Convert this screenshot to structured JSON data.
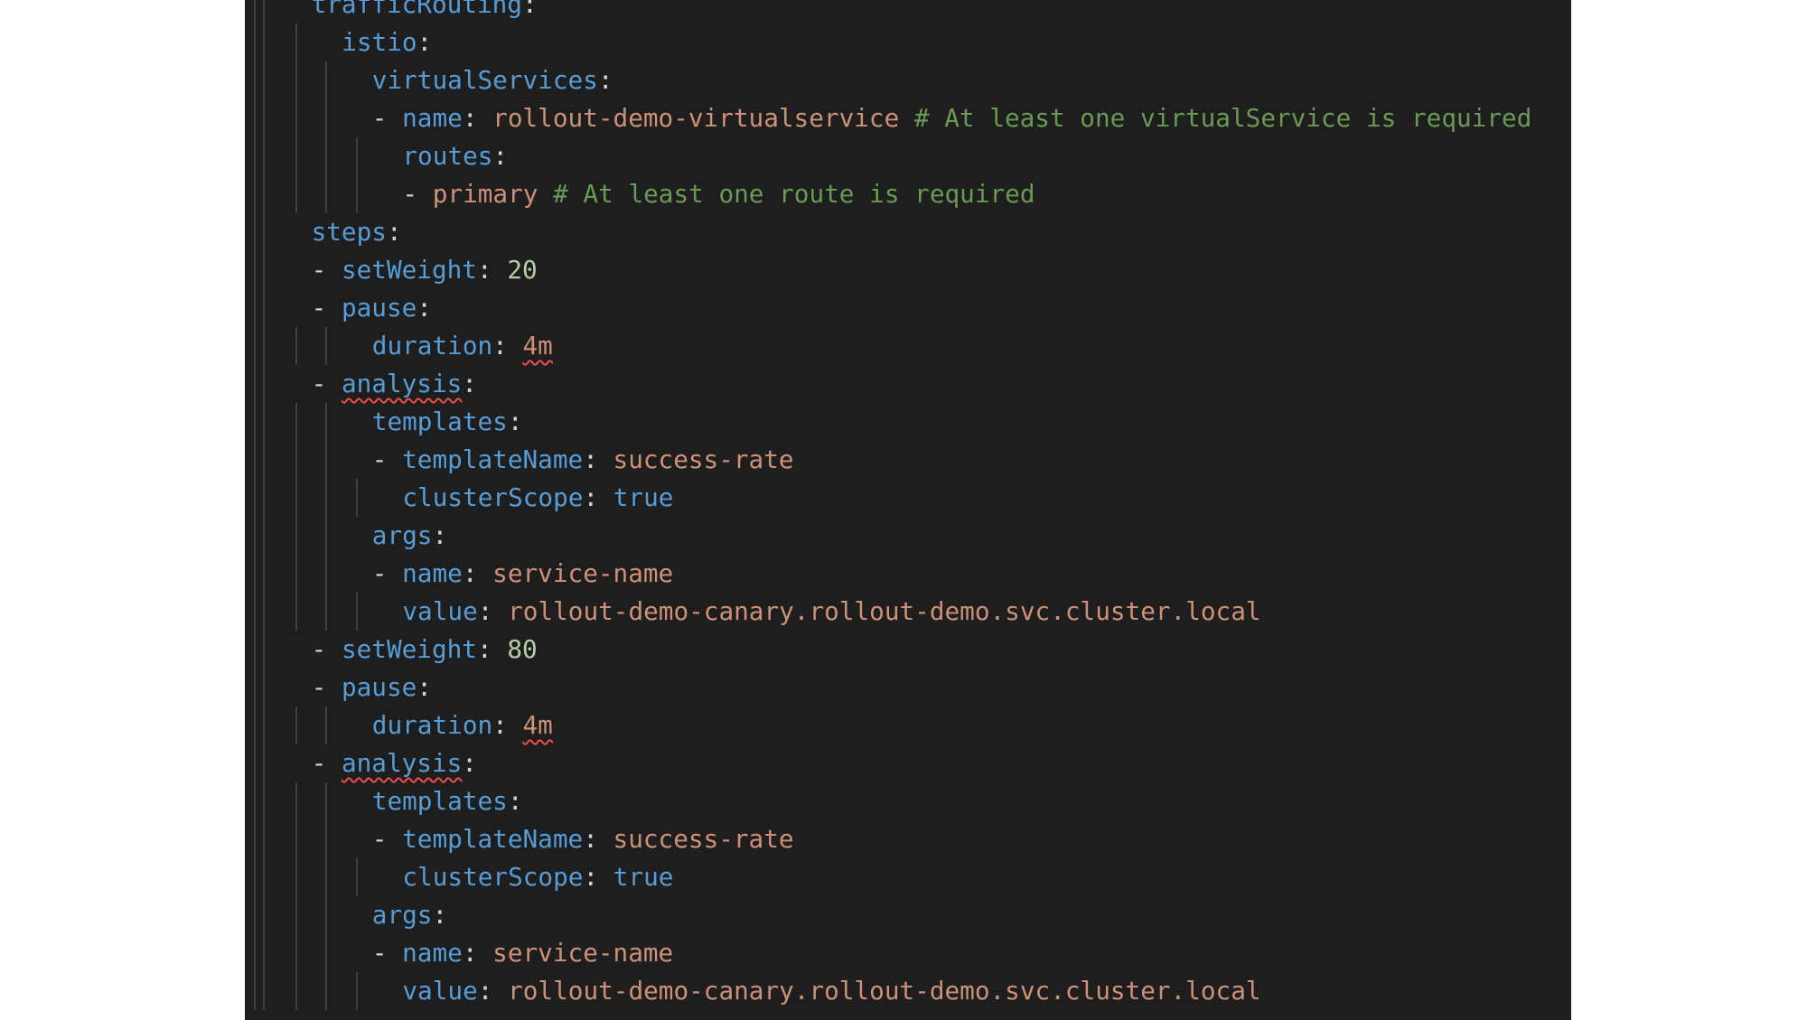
{
  "editor": {
    "language": "yaml",
    "colors": {
      "background": "#1e1e1e",
      "key": "#569cd6",
      "string": "#ce9178",
      "number": "#b5cea8",
      "boolean": "#569cd6",
      "comment": "#6a9955",
      "punctuation": "#d4d4d4",
      "error_squiggle": "#f14c4c"
    },
    "lines": [
      {
        "indent": 2,
        "tokens": [
          {
            "t": "trafficRouting",
            "c": "key"
          },
          {
            "t": ":",
            "c": "punct"
          }
        ]
      },
      {
        "indent": 3,
        "tokens": [
          {
            "t": "istio",
            "c": "key"
          },
          {
            "t": ":",
            "c": "punct"
          }
        ]
      },
      {
        "indent": 4,
        "tokens": [
          {
            "t": "virtualServices",
            "c": "key"
          },
          {
            "t": ":",
            "c": "punct"
          }
        ]
      },
      {
        "indent": 4,
        "tokens": [
          {
            "t": "- ",
            "c": "dash"
          },
          {
            "t": "name",
            "c": "key"
          },
          {
            "t": ": ",
            "c": "punct"
          },
          {
            "t": "rollout-demo-virtualservice ",
            "c": "str"
          },
          {
            "t": "# At least one virtualService is required",
            "c": "comment"
          }
        ]
      },
      {
        "indent": 5,
        "tokens": [
          {
            "t": "routes",
            "c": "key"
          },
          {
            "t": ":",
            "c": "punct"
          }
        ]
      },
      {
        "indent": 5,
        "tokens": [
          {
            "t": "- ",
            "c": "dash"
          },
          {
            "t": "primary ",
            "c": "str"
          },
          {
            "t": "# At least one route is required",
            "c": "comment"
          }
        ]
      },
      {
        "indent": 2,
        "tokens": [
          {
            "t": "steps",
            "c": "key"
          },
          {
            "t": ":",
            "c": "punct"
          }
        ]
      },
      {
        "indent": 2,
        "tokens": [
          {
            "t": "- ",
            "c": "dash"
          },
          {
            "t": "setWeight",
            "c": "key"
          },
          {
            "t": ": ",
            "c": "punct"
          },
          {
            "t": "20",
            "c": "num"
          }
        ]
      },
      {
        "indent": 2,
        "tokens": [
          {
            "t": "- ",
            "c": "dash"
          },
          {
            "t": "pause",
            "c": "key"
          },
          {
            "t": ":",
            "c": "punct"
          }
        ]
      },
      {
        "indent": 4,
        "tokens": [
          {
            "t": "duration",
            "c": "key"
          },
          {
            "t": ": ",
            "c": "punct"
          },
          {
            "t": "4m",
            "c": "str",
            "squiggle": true
          }
        ]
      },
      {
        "indent": 2,
        "tokens": [
          {
            "t": "- ",
            "c": "dash"
          },
          {
            "t": "analysis",
            "c": "key",
            "squiggle": true
          },
          {
            "t": ":",
            "c": "punct"
          }
        ]
      },
      {
        "indent": 4,
        "tokens": [
          {
            "t": "templates",
            "c": "key"
          },
          {
            "t": ":",
            "c": "punct"
          }
        ]
      },
      {
        "indent": 4,
        "tokens": [
          {
            "t": "- ",
            "c": "dash"
          },
          {
            "t": "templateName",
            "c": "key"
          },
          {
            "t": ": ",
            "c": "punct"
          },
          {
            "t": "success-rate",
            "c": "str"
          }
        ]
      },
      {
        "indent": 5,
        "tokens": [
          {
            "t": "clusterScope",
            "c": "key"
          },
          {
            "t": ": ",
            "c": "punct"
          },
          {
            "t": "true",
            "c": "bool"
          }
        ]
      },
      {
        "indent": 4,
        "tokens": [
          {
            "t": "args",
            "c": "key"
          },
          {
            "t": ":",
            "c": "punct"
          }
        ]
      },
      {
        "indent": 4,
        "tokens": [
          {
            "t": "- ",
            "c": "dash"
          },
          {
            "t": "name",
            "c": "key"
          },
          {
            "t": ": ",
            "c": "punct"
          },
          {
            "t": "service-name",
            "c": "str"
          }
        ]
      },
      {
        "indent": 5,
        "tokens": [
          {
            "t": "value",
            "c": "key"
          },
          {
            "t": ": ",
            "c": "punct"
          },
          {
            "t": "rollout-demo-canary.rollout-demo.svc.cluster.local",
            "c": "str"
          }
        ]
      },
      {
        "indent": 2,
        "tokens": [
          {
            "t": "- ",
            "c": "dash"
          },
          {
            "t": "setWeight",
            "c": "key"
          },
          {
            "t": ": ",
            "c": "punct"
          },
          {
            "t": "80",
            "c": "num"
          }
        ]
      },
      {
        "indent": 2,
        "tokens": [
          {
            "t": "- ",
            "c": "dash"
          },
          {
            "t": "pause",
            "c": "key"
          },
          {
            "t": ":",
            "c": "punct"
          }
        ]
      },
      {
        "indent": 4,
        "tokens": [
          {
            "t": "duration",
            "c": "key"
          },
          {
            "t": ": ",
            "c": "punct"
          },
          {
            "t": "4m",
            "c": "str",
            "squiggle": true
          }
        ]
      },
      {
        "indent": 2,
        "tokens": [
          {
            "t": "- ",
            "c": "dash"
          },
          {
            "t": "analysis",
            "c": "key",
            "squiggle": true
          },
          {
            "t": ":",
            "c": "punct"
          }
        ]
      },
      {
        "indent": 4,
        "tokens": [
          {
            "t": "templates",
            "c": "key"
          },
          {
            "t": ":",
            "c": "punct"
          }
        ]
      },
      {
        "indent": 4,
        "tokens": [
          {
            "t": "- ",
            "c": "dash"
          },
          {
            "t": "templateName",
            "c": "key"
          },
          {
            "t": ": ",
            "c": "punct"
          },
          {
            "t": "success-rate",
            "c": "str"
          }
        ]
      },
      {
        "indent": 5,
        "tokens": [
          {
            "t": "clusterScope",
            "c": "key"
          },
          {
            "t": ": ",
            "c": "punct"
          },
          {
            "t": "true",
            "c": "bool"
          }
        ]
      },
      {
        "indent": 4,
        "tokens": [
          {
            "t": "args",
            "c": "key"
          },
          {
            "t": ":",
            "c": "punct"
          }
        ]
      },
      {
        "indent": 4,
        "tokens": [
          {
            "t": "- ",
            "c": "dash"
          },
          {
            "t": "name",
            "c": "key"
          },
          {
            "t": ": ",
            "c": "punct"
          },
          {
            "t": "service-name",
            "c": "str"
          }
        ]
      },
      {
        "indent": 5,
        "tokens": [
          {
            "t": "value",
            "c": "key"
          },
          {
            "t": ": ",
            "c": "punct"
          },
          {
            "t": "rollout-demo-canary.rollout-demo.svc.cluster.local",
            "c": "str"
          }
        ]
      }
    ]
  }
}
